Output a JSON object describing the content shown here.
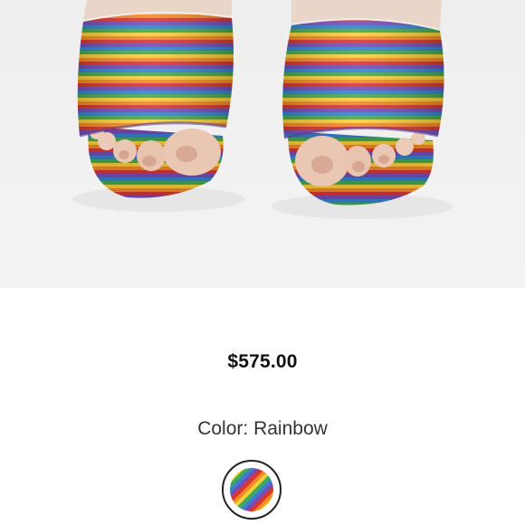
{
  "product": {
    "price": "$575.00",
    "color_label": "Color:",
    "color_value": "Rainbow",
    "swatch_icon": "rainbow-swatch-icon",
    "stripe_colors": [
      "#7a4bb3",
      "#3b7fd0",
      "#43a85a",
      "#f4d03a",
      "#f08a24",
      "#d9362f"
    ]
  }
}
